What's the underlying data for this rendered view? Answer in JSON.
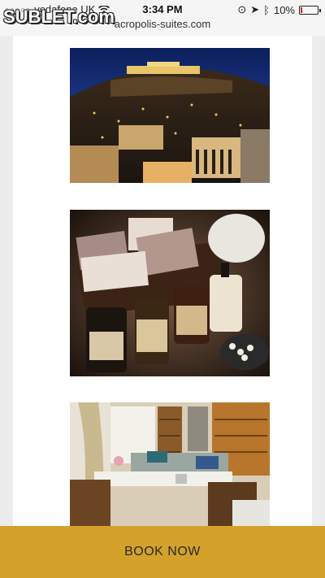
{
  "status": {
    "carrier": "vodafone UK",
    "time": "3:34 PM",
    "battery": "10%",
    "battery_level": 0.1
  },
  "browser": {
    "url": "acropolis-suites.com"
  },
  "watermark": "SUBLET.com",
  "gallery": [
    {
      "subject": "acropolis-night-view"
    },
    {
      "subject": "toiletries-basket"
    },
    {
      "subject": "living-room-interior"
    }
  ],
  "cta": {
    "label": "BOOK NOW",
    "color": "#d4a22a"
  }
}
